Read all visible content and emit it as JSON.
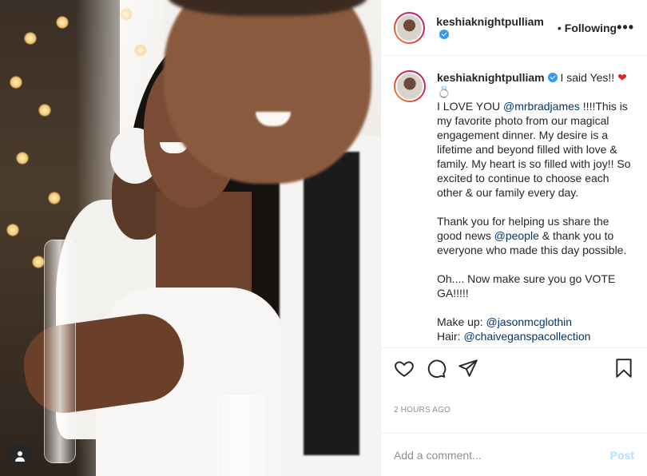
{
  "header": {
    "username": "keshiaknightpulliam",
    "separator": "•",
    "follow_status": "Following",
    "more_label": "•••"
  },
  "caption": {
    "username": "keshiaknightpulliam",
    "line1": "I said Yes!! ",
    "emoji_heart": "❤",
    "emoji_ring": "💍",
    "p1_before": "I LOVE YOU ",
    "mention1": "@mrbradjames",
    "p1_after": " !!!!This is my favorite photo from our magical engagement dinner. My desire is a lifetime and beyond filled with love & family. My heart is so filled with joy!! So excited to continue to choose each other & our family every day.",
    "p2_before": "Thank you for helping us share the good news ",
    "mention2": "@people",
    "p2_after": " & thank you to everyone who made this day possible.",
    "p3": "Oh.... Now make sure you go VOTE GA!!!!!",
    "makeup_label": "Make up: ",
    "mention3": "@jasonmcglothin",
    "hair_label": "Hair: ",
    "mention4": "@chaiveganspacollection"
  },
  "actions": {
    "like_icon": "heart-outline-icon",
    "comment_icon": "comment-bubble-icon",
    "share_icon": "paper-plane-icon",
    "save_icon": "bookmark-icon"
  },
  "timestamp": "2 HOURS AGO",
  "comment": {
    "placeholder": "Add a comment...",
    "post_label": "Post"
  },
  "colors": {
    "mention": "#00376b",
    "verified": "#3897f0",
    "post_disabled": "#b2dffc",
    "muted": "#8e8e8e"
  }
}
